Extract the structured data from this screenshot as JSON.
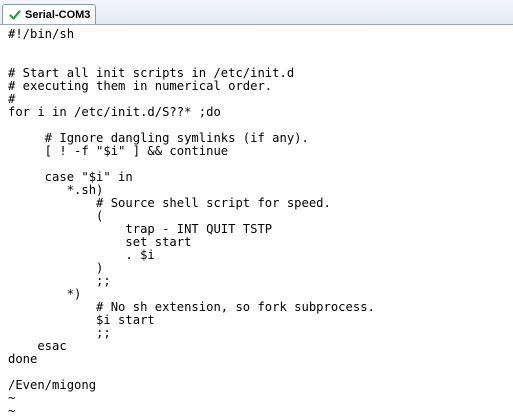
{
  "window": {
    "tab_label": "Serial-COM3",
    "tab_icon": "green-check-icon",
    "accent_color": "#2a9d3a"
  },
  "terminal": {
    "lines": [
      "#!/bin/sh",
      "",
      "",
      "# Start all init scripts in /etc/init.d",
      "# executing them in numerical order.",
      "#",
      "for i in /etc/init.d/S??* ;do",
      "",
      "     # Ignore dangling symlinks (if any).",
      "     [ ! -f \"$i\" ] && continue",
      "",
      "     case \"$i\" in",
      "        *.sh)",
      "            # Source shell script for speed.",
      "            (",
      "                trap - INT QUIT TSTP",
      "                set start",
      "                . $i",
      "            )",
      "            ;;",
      "        *)",
      "            # No sh extension, so fork subprocess.",
      "            $i start",
      "            ;;",
      "    esac",
      "done",
      "",
      "/Even/migong",
      "~",
      "~"
    ]
  }
}
